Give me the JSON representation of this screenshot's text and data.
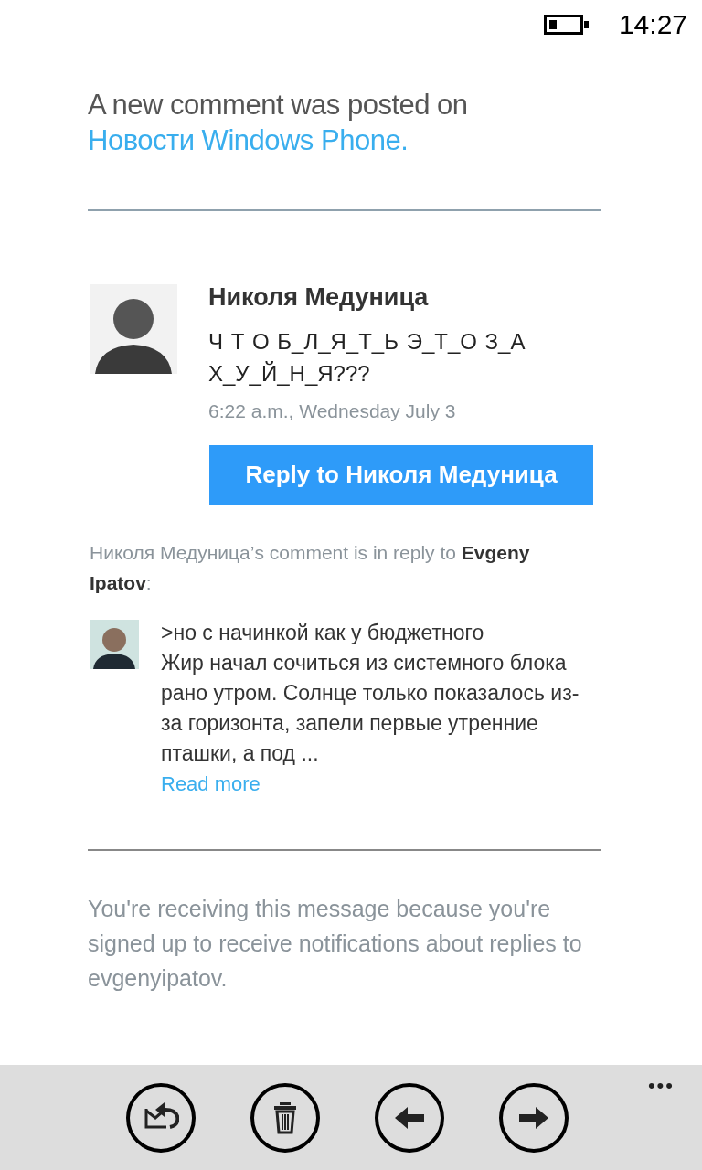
{
  "status_bar": {
    "time": "14:27"
  },
  "header": {
    "intro": "A new comment was posted on",
    "site_link": "Новости Windows Phone."
  },
  "comment": {
    "author": "Николя Медуница",
    "text": "Ч Т О Б_Л_Я_Т_Ь Э_Т_О З_А Х_У_Й_Н_Я???",
    "time": "6:22 a.m., Wednesday July 3",
    "reply_button": "Reply to Николя Медуница"
  },
  "in_reply": {
    "note": "Николя Медуница’s comment is in reply to **Evgeny Ipatov**:",
    "quote_first": ">но с начинкой как у бюджетного",
    "quote_body": "Жир начал сочиться из системного блока рано утром. Солнце только показалось из-за горизонта, запели первые утренние пташки, а под ...",
    "read_more": "Read more"
  },
  "footer": {
    "notice": "You're receiving this message because you're signed up to receive notifications about replies to evgenyipatov."
  },
  "app_bar": {
    "buttons": [
      {
        "kind": "reply"
      },
      {
        "kind": "delete"
      },
      {
        "kind": "back"
      },
      {
        "kind": "forward"
      }
    ],
    "more": "•••"
  }
}
